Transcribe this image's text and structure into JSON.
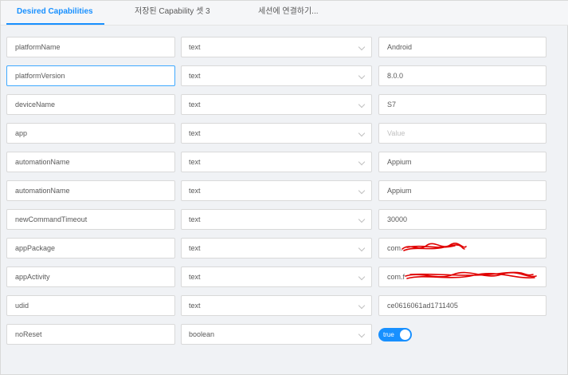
{
  "tabs": [
    {
      "label": "Desired Capabilities",
      "active": true
    },
    {
      "label": "저장된 Capability 셋 3",
      "active": false
    },
    {
      "label": "세션에 연결하기...",
      "active": false
    }
  ],
  "rows": [
    {
      "name": "platformName",
      "type": "text",
      "value": "Android"
    },
    {
      "name": "platformVersion",
      "type": "text",
      "value": "8.0.0"
    },
    {
      "name": "deviceName",
      "type": "text",
      "value": "S7"
    },
    {
      "name": "app",
      "type": "text",
      "value": "",
      "placeholder": "Value"
    },
    {
      "name": "automationName",
      "type": "text",
      "value": "Appium"
    },
    {
      "name": "automationName",
      "type": "text",
      "value": "Appium"
    },
    {
      "name": "newCommandTimeout",
      "type": "text",
      "value": "30000"
    },
    {
      "name": "appPackage",
      "type": "text",
      "value": "com."
    },
    {
      "name": "appActivity",
      "type": "text",
      "value": "com.f"
    },
    {
      "name": "udid",
      "type": "text",
      "value": "ce0616061ad1711405"
    },
    {
      "name": "noReset",
      "type": "boolean",
      "value": "true"
    }
  ],
  "colors": {
    "accent": "#1890ff",
    "redaction": "#e00000"
  },
  "icons": {
    "dropdown": "chevron-down-icon"
  }
}
